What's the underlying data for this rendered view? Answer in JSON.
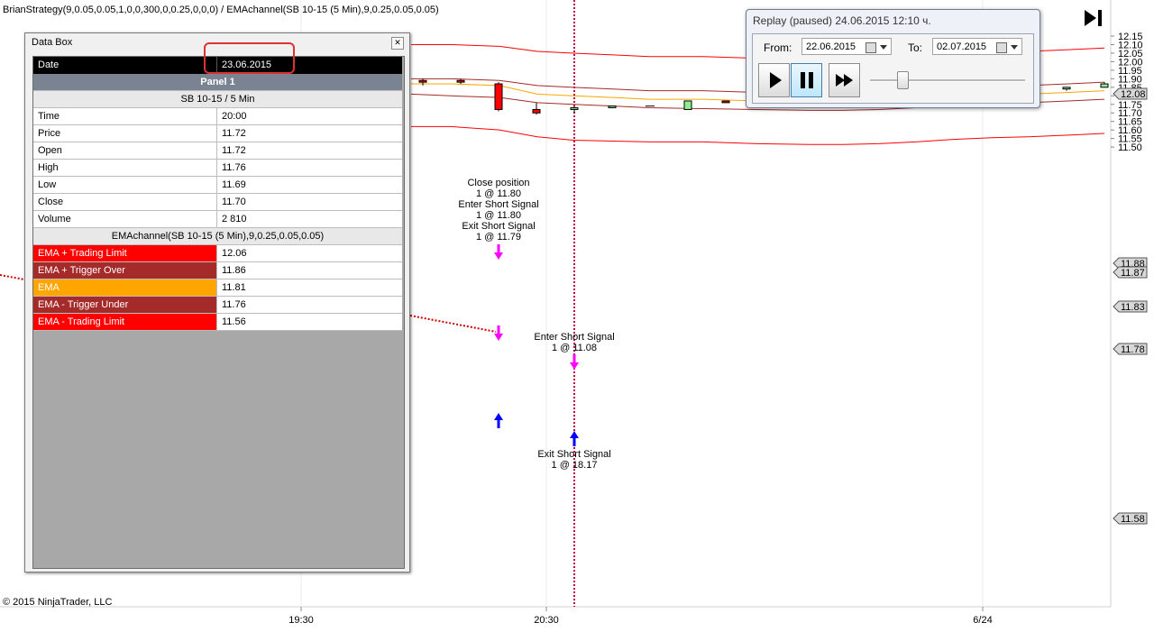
{
  "title": "BrianStrategy(9,0.05,0.05,1,0,0,300,0,0.25,0,0,0) / EMAchannel(SB 10-15 (5 Min),9,0.25,0.05,0.05)",
  "copyright": "© 2015 NinjaTrader, LLC",
  "data_box": {
    "title": "Data Box",
    "date_label": "Date",
    "date_value": "23.06.2015",
    "panel_label": "Panel 1",
    "instrument": "SB 10-15 / 5 Min",
    "rows": [
      {
        "label": "Time",
        "value": "20:00"
      },
      {
        "label": "Price",
        "value": "11.72"
      },
      {
        "label": "Open",
        "value": "11.72"
      },
      {
        "label": "High",
        "value": "11.76"
      },
      {
        "label": "Low",
        "value": "11.69"
      },
      {
        "label": "Close",
        "value": "11.70"
      },
      {
        "label": "Volume",
        "value": "2 810"
      }
    ],
    "indicator_header": "EMAchannel(SB 10-15 (5 Min),9,0.25,0.05,0.05)",
    "indicator_rows": [
      {
        "label": "EMA + Trading Limit",
        "value": "12.06",
        "color": "#ff0000"
      },
      {
        "label": "EMA + Trigger Over",
        "value": "11.86",
        "color": "#a52a2a"
      },
      {
        "label": "EMA",
        "value": "11.81",
        "color": "#ffa500"
      },
      {
        "label": "EMA - Trigger Under",
        "value": "11.76",
        "color": "#a52a2a"
      },
      {
        "label": "EMA - Trading Limit",
        "value": "11.56",
        "color": "#ff0000"
      }
    ]
  },
  "replay": {
    "title": "Replay (paused) 24.06.2015 12:10 ч.",
    "from_label": "From:",
    "from_value": "22.06.2015",
    "to_label": "To:",
    "to_value": "02.07.2015",
    "play_icon": "play-icon",
    "pause_icon": "pause-icon",
    "fast_forward_icon": "fast-forward-icon"
  },
  "chart_data": {
    "type": "candlestick",
    "y_ticks": [
      "12.15",
      "12.10",
      "12.05",
      "12.00",
      "11.95",
      "11.90",
      "11.85",
      "11.80",
      "11.75",
      "11.70",
      "11.65",
      "11.60",
      "11.55",
      "11.50"
    ],
    "x_ticks": [
      "19:30",
      "20:30",
      "6/24"
    ],
    "price_markers": [
      {
        "label": "12.08",
        "value": 12.08
      },
      {
        "label": "11.88",
        "value": 11.88
      },
      {
        "label": "11.87",
        "value": 11.87
      },
      {
        "label": "11.83",
        "value": 11.83
      },
      {
        "label": "11.78",
        "value": 11.78
      },
      {
        "label": "11.58",
        "value": 11.58
      }
    ],
    "annotations": [
      {
        "lines": [
          "Close position",
          "1 @ 11.80",
          "Enter Short Signal",
          "1 @ 11.80",
          "Exit Short Signal",
          "1 @ 11.79"
        ]
      },
      {
        "lines": [
          "Enter Short Signal",
          "1 @ 11.08"
        ]
      },
      {
        "lines": [
          "Exit Short Signal",
          "1 @ 18.17"
        ]
      }
    ],
    "colors": {
      "up": "#90ee90",
      "down": "#ff0000",
      "ema": "#ffa500",
      "trigger": "#a52a2a",
      "limit": "#ff0000"
    }
  }
}
